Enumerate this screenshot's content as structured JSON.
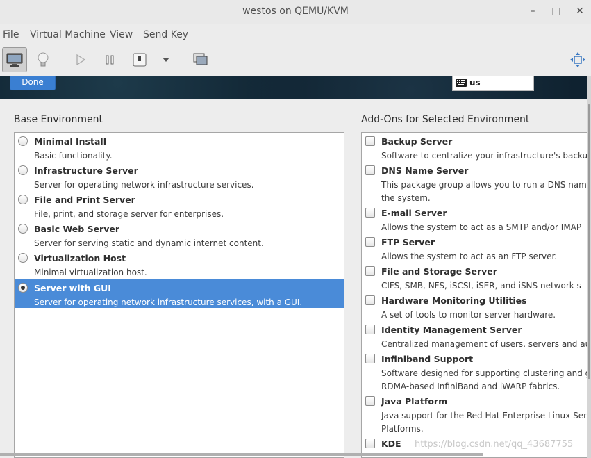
{
  "window": {
    "title": "westos on QEMU/KVM",
    "controls": {
      "minimize": "–",
      "maximize": "□",
      "close": "✕"
    }
  },
  "menubar": {
    "items": [
      "File",
      "Virtual Machine",
      "View",
      "Send Key"
    ]
  },
  "toolbar": {
    "buttons": [
      "console-icon",
      "lightbulb-icon",
      "play-icon",
      "pause-icon",
      "power-icon",
      "chevron-down-icon",
      "snapshots-icon",
      "fullscreen-icon"
    ]
  },
  "header": {
    "done_label": "Done",
    "keyboard_layout": "us"
  },
  "base_environment": {
    "title": "Base Environment",
    "items": [
      {
        "name": "Minimal Install",
        "desc": "Basic functionality.",
        "selected": false
      },
      {
        "name": "Infrastructure Server",
        "desc": "Server for operating network infrastructure services.",
        "selected": false
      },
      {
        "name": "File and Print Server",
        "desc": "File, print, and storage server for enterprises.",
        "selected": false
      },
      {
        "name": "Basic Web Server",
        "desc": "Server for serving static and dynamic internet content.",
        "selected": false
      },
      {
        "name": "Virtualization Host",
        "desc": "Minimal virtualization host.",
        "selected": false
      },
      {
        "name": "Server with GUI",
        "desc": "Server for operating network infrastructure services, with a GUI.",
        "selected": true
      }
    ]
  },
  "addons": {
    "title": "Add-Ons for Selected Environment",
    "items": [
      {
        "name": "Backup Server",
        "desc": [
          "Software to centralize your infrastructure's backu"
        ]
      },
      {
        "name": "DNS Name Server",
        "desc": [
          "This package group allows you to run a DNS nam",
          "the system."
        ]
      },
      {
        "name": "E-mail Server",
        "desc": [
          "Allows the system to act as a SMTP and/or IMAP"
        ]
      },
      {
        "name": "FTP Server",
        "desc": [
          "Allows the system to act as an FTP server."
        ]
      },
      {
        "name": "File and Storage Server",
        "desc": [
          "CIFS, SMB, NFS, iSCSI, iSER, and iSNS network s"
        ]
      },
      {
        "name": "Hardware Monitoring Utilities",
        "desc": [
          "A set of tools to monitor server hardware."
        ]
      },
      {
        "name": "Identity Management Server",
        "desc": [
          "Centralized management of users, servers and aut"
        ]
      },
      {
        "name": "Infiniband Support",
        "desc": [
          "Software designed for supporting clustering and g",
          "RDMA-based InfiniBand and iWARP fabrics."
        ]
      },
      {
        "name": "Java Platform",
        "desc": [
          "Java support for the Red Hat Enterprise Linux Serv",
          "Platforms."
        ]
      },
      {
        "name": "KDE",
        "desc": []
      }
    ]
  },
  "watermark": "https://blog.csdn.net/qq_43687755",
  "colors": {
    "selection": "#4a8bd8",
    "done_button": "#3a7fd2",
    "banner": "#0f2230"
  }
}
